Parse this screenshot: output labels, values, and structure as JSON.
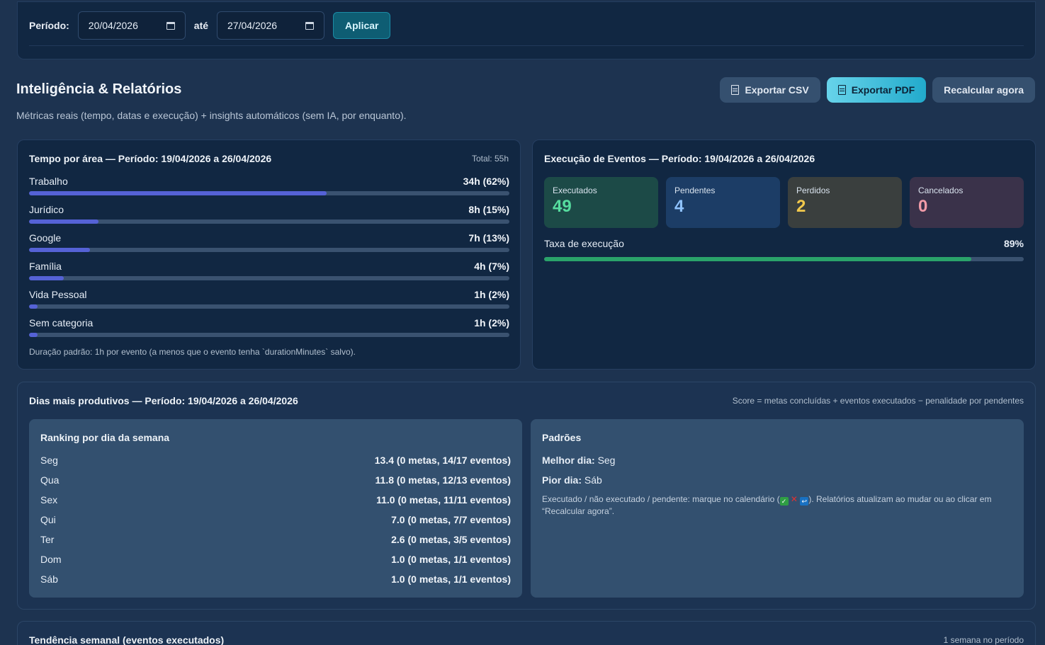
{
  "filter": {
    "period_label": "Período:",
    "start_date": "20/04/2026",
    "until_label": "até",
    "end_date": "27/04/2026",
    "apply_label": "Aplicar"
  },
  "header": {
    "title": "Inteligência & Relatórios",
    "subtitle": "Métricas reais (tempo, datas e execução) + insights automáticos (sem IA, por enquanto).",
    "export_csv": "Exportar CSV",
    "export_pdf": "Exportar PDF",
    "recalc": "Recalcular agora"
  },
  "time_by_area": {
    "title": "Tempo por área — Período: 19/04/2026 a 26/04/2026",
    "total": "Total: 55h",
    "items": [
      {
        "name": "Trabalho",
        "value": "34h (62%)",
        "fraction": 0.62
      },
      {
        "name": "Jurídico",
        "value": "8h (15%)",
        "fraction": 0.145
      },
      {
        "name": "Google",
        "value": "7h (13%)",
        "fraction": 0.127
      },
      {
        "name": "Família",
        "value": "4h (7%)",
        "fraction": 0.073
      },
      {
        "name": "Vida Pessoal",
        "value": "1h (2%)",
        "fraction": 0.018
      },
      {
        "name": "Sem categoria",
        "value": "1h (2%)",
        "fraction": 0.018
      }
    ],
    "footnote": "Duração padrão: 1h por evento (a menos que o evento tenha `durationMinutes` salvo)."
  },
  "events_execution": {
    "title": "Execução de Eventos — Período: 19/04/2026 a 26/04/2026",
    "stats": [
      {
        "label": "Executados",
        "value": "49",
        "bg": "#1c4a47",
        "color": "#56dd9f"
      },
      {
        "label": "Pendentes",
        "value": "4",
        "bg": "#1c3d66",
        "color": "#8fc3ff"
      },
      {
        "label": "Perdidos",
        "value": "2",
        "bg": "#3a3f3e",
        "color": "#f2c94c"
      },
      {
        "label": "Cancelados",
        "value": "0",
        "bg": "#3a324a",
        "color": "#f19ba8"
      }
    ],
    "rate_label": "Taxa de execução",
    "rate_value": "89%",
    "rate_fraction": 0.89
  },
  "productive_days": {
    "title": "Dias mais produtivos — Período: 19/04/2026 a 26/04/2026",
    "score_note": "Score = metas concluídas + eventos executados − penalidade por pendentes",
    "ranking_title": "Ranking por dia da semana",
    "ranking": [
      {
        "day": "Seg",
        "value": "13.4 (0 metas, 14/17 eventos)"
      },
      {
        "day": "Qua",
        "value": "11.8 (0 metas, 12/13 eventos)"
      },
      {
        "day": "Sex",
        "value": "11.0 (0 metas, 11/11 eventos)"
      },
      {
        "day": "Qui",
        "value": "7.0 (0 metas, 7/7 eventos)"
      },
      {
        "day": "Ter",
        "value": "2.6 (0 metas, 3/5 eventos)"
      },
      {
        "day": "Dom",
        "value": "1.0 (0 metas, 1/1 eventos)"
      },
      {
        "day": "Sáb",
        "value": "1.0 (0 metas, 1/1 eventos)"
      }
    ],
    "patterns_title": "Padrões",
    "best_label": "Melhor dia:",
    "best_value": "Seg",
    "worst_label": "Pior dia:",
    "worst_value": "Sáb",
    "note_before": "Executado / não executado / pendente: marque no calendário (",
    "note_after": "). Relatórios atualizam ao mudar ou ao clicar em “Recalcular agora”."
  },
  "weekly_trend": {
    "title": "Tendência semanal (eventos executados)",
    "note": "1 semana no período"
  },
  "colors": {
    "bar": "#5562d6",
    "rate_bar": "#2aa36a",
    "accent": "#22aacc"
  }
}
